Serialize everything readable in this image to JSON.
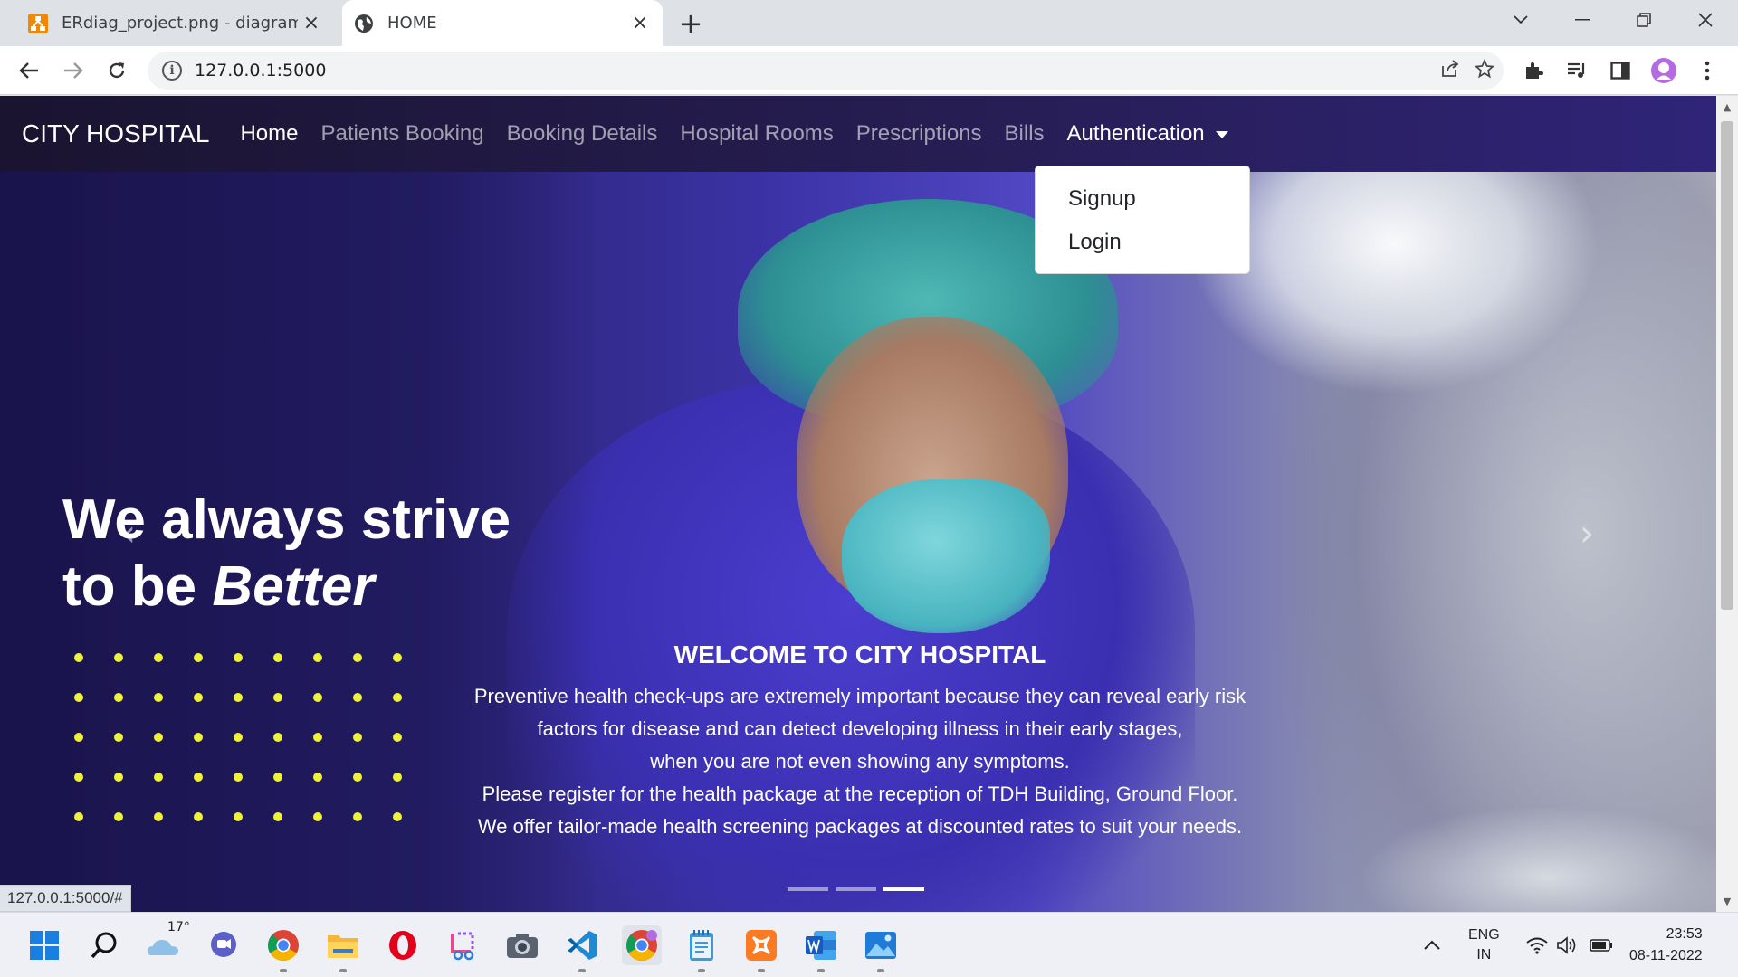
{
  "browser": {
    "tabs": [
      {
        "title": "ERdiag_project.png - diagrams.net",
        "icon": "drawio-icon",
        "active": false
      },
      {
        "title": "HOME",
        "icon": "globe-icon",
        "active": true
      }
    ],
    "url": "127.0.0.1:5000"
  },
  "navbar": {
    "brand": "CITY HOSPITAL",
    "links": [
      "Home",
      "Patients Booking",
      "Booking Details",
      "Hospital Rooms",
      "Prescriptions",
      "Bills",
      "Authentication"
    ],
    "active": "Home"
  },
  "dropdown": {
    "items": [
      "Signup",
      "Login"
    ]
  },
  "hero": {
    "headline_line1": "We always strive",
    "headline_line2_prefix": "to be ",
    "headline_line2_emph": "Better",
    "caption_title": "WELCOME TO CITY HOSPITAL",
    "caption_lines": [
      "Preventive health check-ups are extremely important because they can reveal early risk",
      "factors for disease and can detect developing illness in their early stages,",
      "when you are not even showing any symptoms.",
      "Please register for the health package at the reception of TDH Building, Ground Floor.",
      "We offer tailor-made health screening packages at discounted rates to suit your needs."
    ],
    "slide_count": 3,
    "active_slide": 3
  },
  "status_link": "127.0.0.1:5000/#",
  "taskbar": {
    "weather_temp": "17°",
    "lang_line1": "ENG",
    "lang_line2": "IN",
    "time": "23:53",
    "date": "08-11-2022"
  },
  "colors": {
    "navbar": "#261d52",
    "dot_yellow": "#eef23a",
    "brand_purple": "#3b33a6"
  }
}
